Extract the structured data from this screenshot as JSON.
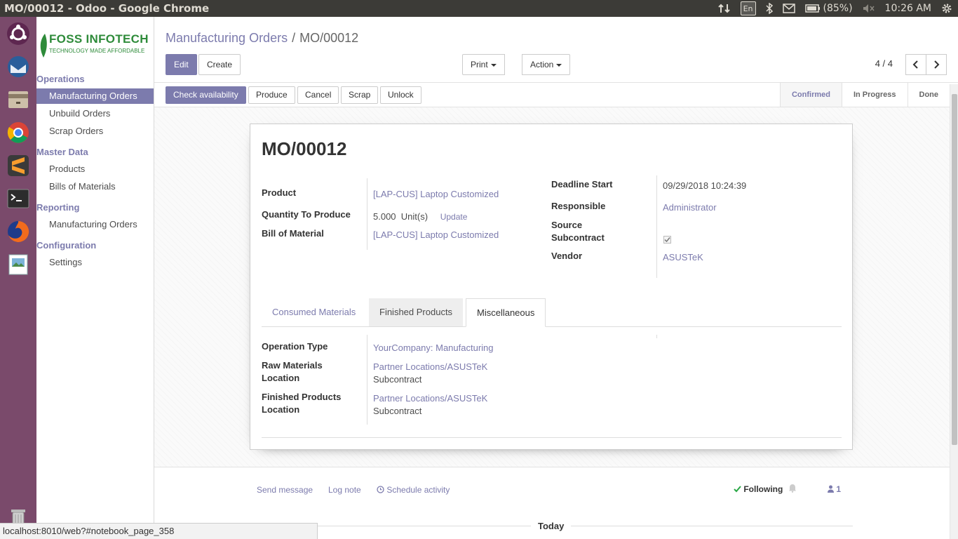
{
  "os": {
    "window_title": "MO/00012 - Odoo - Google Chrome",
    "keyboard_layout": "En",
    "battery": "(85%)",
    "clock": "10:26 AM"
  },
  "sidebar": {
    "logo": {
      "name": "FOSS INFOTECH",
      "tagline": "TECHNOLOGY MADE AFFORDABLE"
    },
    "sections": [
      {
        "title": "Operations",
        "items": [
          "Manufacturing Orders",
          "Unbuild Orders",
          "Scrap Orders"
        ]
      },
      {
        "title": "Master Data",
        "items": [
          "Products",
          "Bills of Materials"
        ]
      },
      {
        "title": "Reporting",
        "items": [
          "Manufacturing Orders"
        ]
      },
      {
        "title": "Configuration",
        "items": [
          "Settings"
        ]
      }
    ]
  },
  "breadcrumb": {
    "parent": "Manufacturing Orders",
    "separator": "/",
    "current": "MO/00012"
  },
  "toolbar": {
    "edit": "Edit",
    "create": "Create",
    "print": "Print",
    "action": "Action"
  },
  "pager": {
    "label": "4 / 4"
  },
  "actions": {
    "check_availability": "Check availability",
    "produce": "Produce",
    "cancel": "Cancel",
    "scrap": "Scrap",
    "unlock": "Unlock"
  },
  "stages": [
    "Confirmed",
    "In Progress",
    "Done"
  ],
  "active_stage": "Confirmed",
  "form": {
    "title": "MO/00012",
    "product_label": "Product",
    "product_value": "[LAP-CUS] Laptop Customized",
    "qty_label": "Quantity To Produce",
    "qty_value": "5.000",
    "qty_unit": "Unit(s)",
    "qty_update": "Update",
    "bom_label": "Bill of Material",
    "bom_value": "[LAP-CUS] Laptop Customized",
    "deadline_label": "Deadline Start",
    "deadline_value": "09/29/2018 10:24:39",
    "responsible_label": "Responsible",
    "responsible_value": "Administrator",
    "source_subcontract_label_1": "Source",
    "source_subcontract_label_2": "Subcontract",
    "source_subcontract_checked": true,
    "vendor_label": "Vendor",
    "vendor_value": "ASUSTeK"
  },
  "tabs": [
    "Consumed Materials",
    "Finished Products",
    "Miscellaneous"
  ],
  "active_tab": "Miscellaneous",
  "misc": {
    "op_type_label": "Operation Type",
    "op_type_value": "YourCompany: Manufacturing",
    "raw_loc_label_1": "Raw Materials",
    "raw_loc_label_2": "Location",
    "raw_loc_link": "Partner Locations/ASUSTeK",
    "raw_loc_sub": "Subcontract",
    "fin_loc_label_1": "Finished Products",
    "fin_loc_label_2": "Location",
    "fin_loc_link": "Partner Locations/ASUSTeK",
    "fin_loc_sub": "Subcontract"
  },
  "chatter": {
    "send_message": "Send message",
    "log_note": "Log note",
    "schedule_activity": "Schedule activity",
    "following": "Following",
    "followers_count": "1",
    "today": "Today"
  },
  "status_url": "localhost:8010/web?#notebook_page_358",
  "colors": {
    "accent": "#7c7bad",
    "launcher": "#7a4a6b",
    "os_bar": "#3c3b37"
  }
}
